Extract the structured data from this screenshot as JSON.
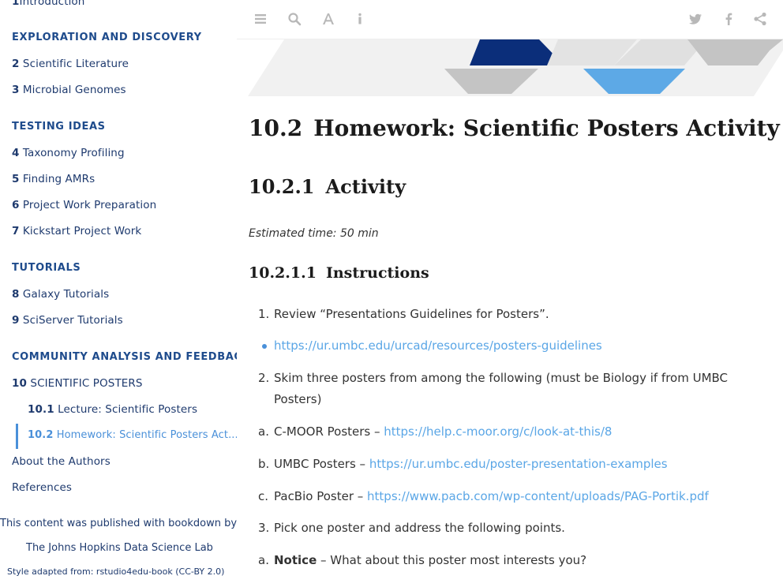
{
  "sidebar": {
    "intro": {
      "num": "1",
      "label": "Introduction"
    },
    "sections": [
      {
        "heading": "EXPLORATION AND DISCOVERY"
      },
      {
        "heading": "TESTING IDEAS"
      },
      {
        "heading": "TUTORIALS"
      },
      {
        "heading": "COMMUNITY ANALYSIS AND FEEDBACK"
      }
    ],
    "items": [
      {
        "num": "2",
        "label": "Scientific Literature"
      },
      {
        "num": "3",
        "label": "Microbial Genomes"
      },
      {
        "num": "4",
        "label": "Taxonomy Profiling"
      },
      {
        "num": "5",
        "label": "Finding AMRs"
      },
      {
        "num": "6",
        "label": "Project Work Preparation"
      },
      {
        "num": "7",
        "label": "Kickstart Project Work"
      },
      {
        "num": "8",
        "label": "Galaxy Tutorials"
      },
      {
        "num": "9",
        "label": "SciServer Tutorials"
      },
      {
        "num": "10",
        "label": "SCIENTIFIC POSTERS"
      }
    ],
    "subitems": [
      {
        "num": "10.1",
        "label": "Lecture: Scientific Posters"
      },
      {
        "num": "10.2",
        "label": "Homework: Scientific Posters Act..."
      }
    ],
    "about": "About the Authors",
    "references": "References",
    "published_by": "This content was published with bookdown by:",
    "lab": "The Johns Hopkins Data Science Lab",
    "style_adapted": "Style adapted from: rstudio4edu-book (CC-BY 2.0)"
  },
  "toolbar": {
    "left_icons": [
      "toc-toggle-icon",
      "search-icon",
      "font-icon",
      "info-icon"
    ],
    "right_icons": [
      "twitter-icon",
      "facebook-icon",
      "share-icon"
    ]
  },
  "content": {
    "title_num": "10.2",
    "title": "Homework: Scientific Posters Activity",
    "h2_num": "10.2.1",
    "h2": "Activity",
    "estimated_time": "Estimated time: 50 min",
    "h3_num": "10.2.1.1",
    "h3": "Instructions",
    "list": [
      {
        "marker": "1.",
        "text": "Review “Presentations Guidelines for Posters”."
      },
      {
        "marker": "•",
        "link": "https://ur.umbc.edu/urcad/resources/posters-guidelines"
      },
      {
        "marker": "2.",
        "text": "Skim three posters from among the following (must be Biology if from UMBC Posters)"
      },
      {
        "marker": "a.",
        "text": "C-MOOR Posters – ",
        "link": "https://help.c-moor.org/c/look-at-this/8"
      },
      {
        "marker": "b.",
        "text": "UMBC Posters – ",
        "link": "https://ur.umbc.edu/poster-presentation-examples"
      },
      {
        "marker": "c.",
        "text": "PacBio Poster – ",
        "link": "https://www.pacb.com/wp-content/uploads/PAG-Portik.pdf"
      },
      {
        "marker": "3.",
        "text": "Pick one poster and address the following points."
      },
      {
        "marker": "a.",
        "bold": "Notice",
        "text": " – What about this poster most interests you?"
      }
    ]
  },
  "colors": {
    "nav_text": "#1e3a6e",
    "nav_heading": "#1e4b8c",
    "active": "#4a90d9",
    "link": "#5aa6e6",
    "banner_navy": "#0b2e7a",
    "banner_blue": "#5da9e6",
    "banner_gray": "#c4c4c4"
  }
}
